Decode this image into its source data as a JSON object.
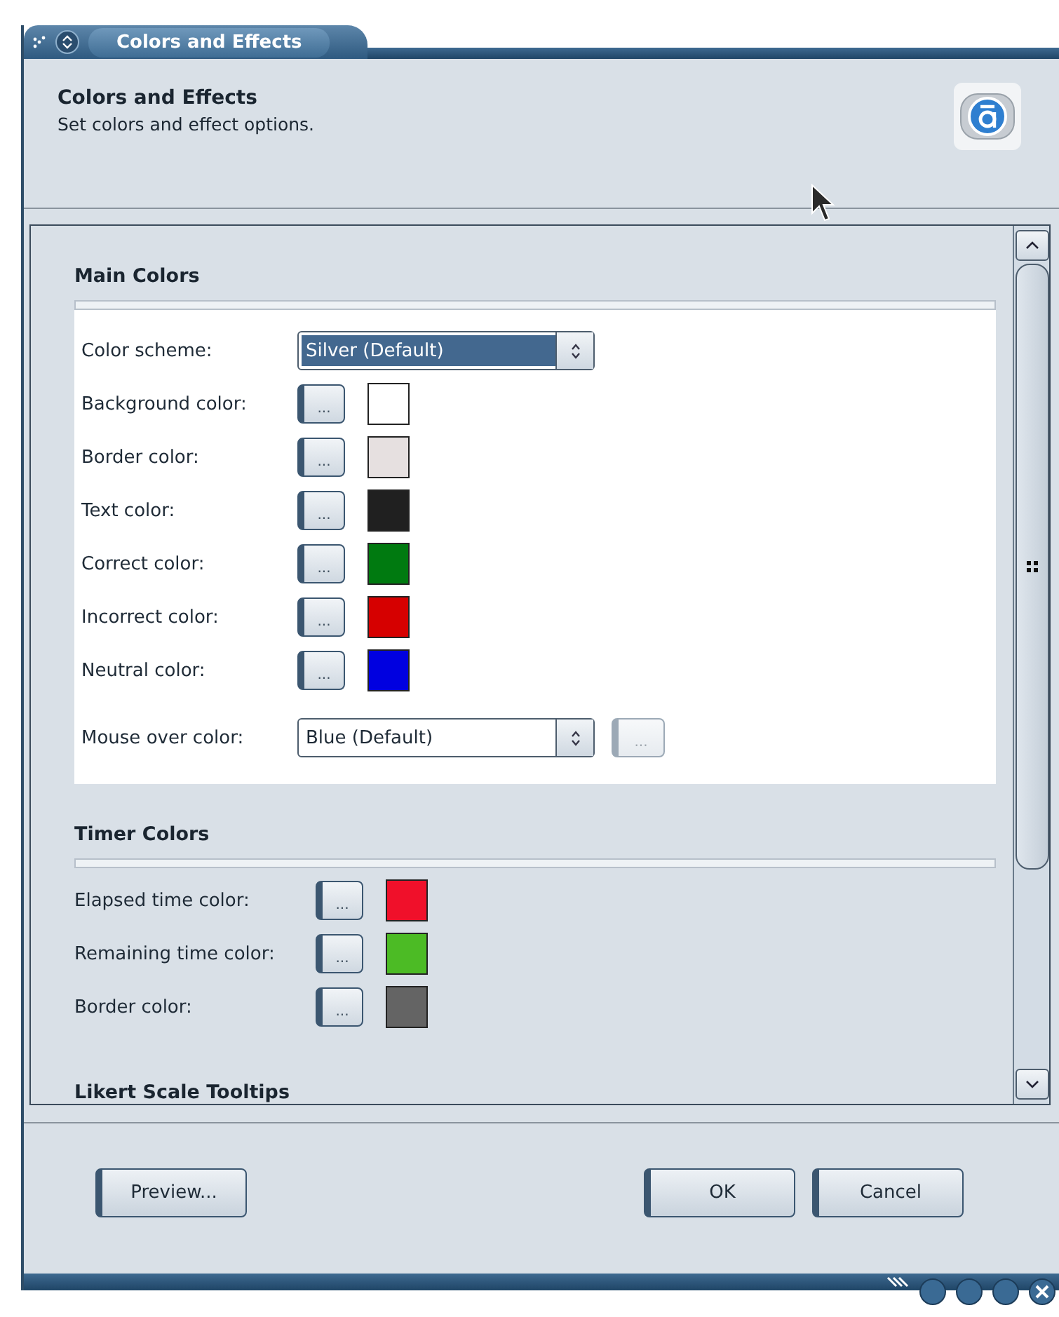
{
  "window": {
    "title": "Colors and Effects"
  },
  "header": {
    "title": "Colors and Effects",
    "subtitle": "Set colors and effect options."
  },
  "sections": [
    {
      "title": "Main Colors",
      "boxed": true,
      "rows": [
        {
          "kind": "dropdown",
          "label": "Color scheme:",
          "value": "Silver (Default)",
          "selected": true
        },
        {
          "kind": "color",
          "label": "Background color:",
          "button": "...",
          "color": "#ffffff"
        },
        {
          "kind": "color",
          "label": "Border color:",
          "button": "...",
          "color": "#e6e0e0"
        },
        {
          "kind": "color",
          "label": "Text color:",
          "button": "...",
          "color": "#202020"
        },
        {
          "kind": "color",
          "label": "Correct color:",
          "button": "...",
          "color": "#007a10"
        },
        {
          "kind": "color",
          "label": "Incorrect color:",
          "button": "...",
          "color": "#d60000"
        },
        {
          "kind": "color",
          "label": "Neutral color:",
          "button": "...",
          "color": "#0000e0"
        },
        {
          "kind": "dropdown",
          "label": "Mouse over color:",
          "value": "Blue (Default)",
          "selected": false,
          "button": "...",
          "button_disabled": true
        }
      ]
    },
    {
      "title": "Timer Colors",
      "boxed": false,
      "rows": [
        {
          "kind": "color",
          "label": "Elapsed time color:",
          "button": "...",
          "color": "#f0102a"
        },
        {
          "kind": "color",
          "label": "Remaining time color:",
          "button": "...",
          "color": "#4cbb25"
        },
        {
          "kind": "color",
          "label": "Border color:",
          "button": "...",
          "color": "#646464"
        }
      ]
    },
    {
      "title": "Likert Scale Tooltips"
    }
  ],
  "left_buttons": [
    "Preview..."
  ],
  "right_buttons": [
    "OK",
    "Cancel"
  ]
}
